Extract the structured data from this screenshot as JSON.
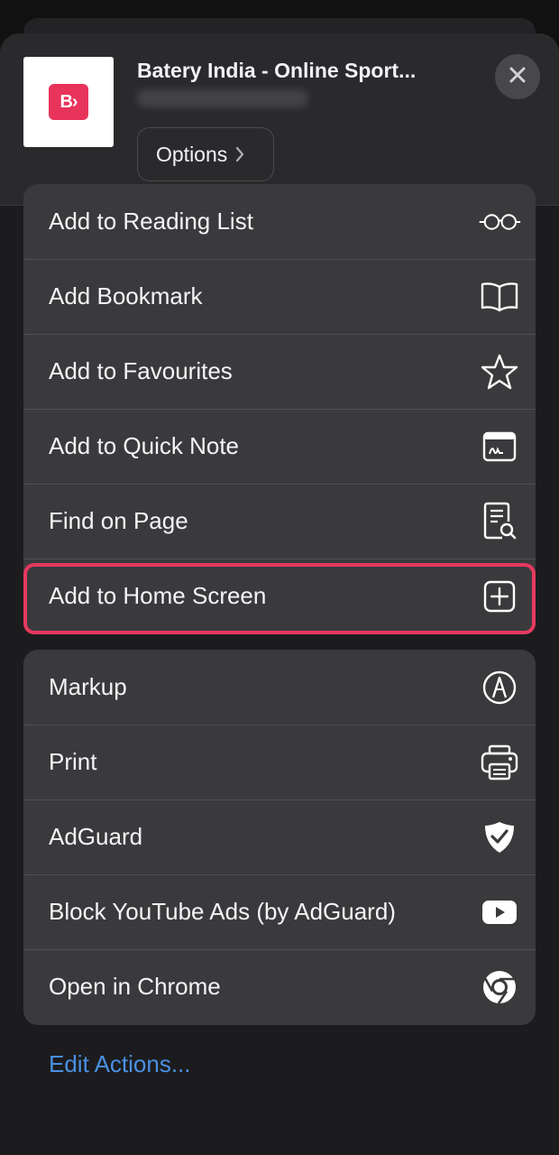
{
  "header": {
    "site_title": "Batery India - Online Sport...",
    "logo_text": "B›",
    "options_label": "Options",
    "close_icon": "close-icon"
  },
  "actions_primary": [
    {
      "label": "Add to Reading List",
      "icon": "glasses-icon"
    },
    {
      "label": "Add Bookmark",
      "icon": "book-icon"
    },
    {
      "label": "Add to Favourites",
      "icon": "star-icon"
    },
    {
      "label": "Add to Quick Note",
      "icon": "quick-note-icon"
    },
    {
      "label": "Find on Page",
      "icon": "find-on-page-icon"
    },
    {
      "label": "Add to Home Screen",
      "icon": "plus-square-icon"
    }
  ],
  "actions_extensions": [
    {
      "label": "Markup",
      "icon": "markup-pen-icon"
    },
    {
      "label": "Print",
      "icon": "printer-icon"
    },
    {
      "label": "AdGuard",
      "icon": "shield-check-icon"
    },
    {
      "label": "Block YouTube Ads (by AdGuard)",
      "icon": "youtube-play-icon"
    },
    {
      "label": "Open in Chrome",
      "icon": "chrome-icon"
    }
  ],
  "footer": {
    "edit_actions_label": "Edit Actions..."
  },
  "colors": {
    "highlight": "#e5395f",
    "link": "#4a90e2",
    "logo": "#e8335a"
  }
}
